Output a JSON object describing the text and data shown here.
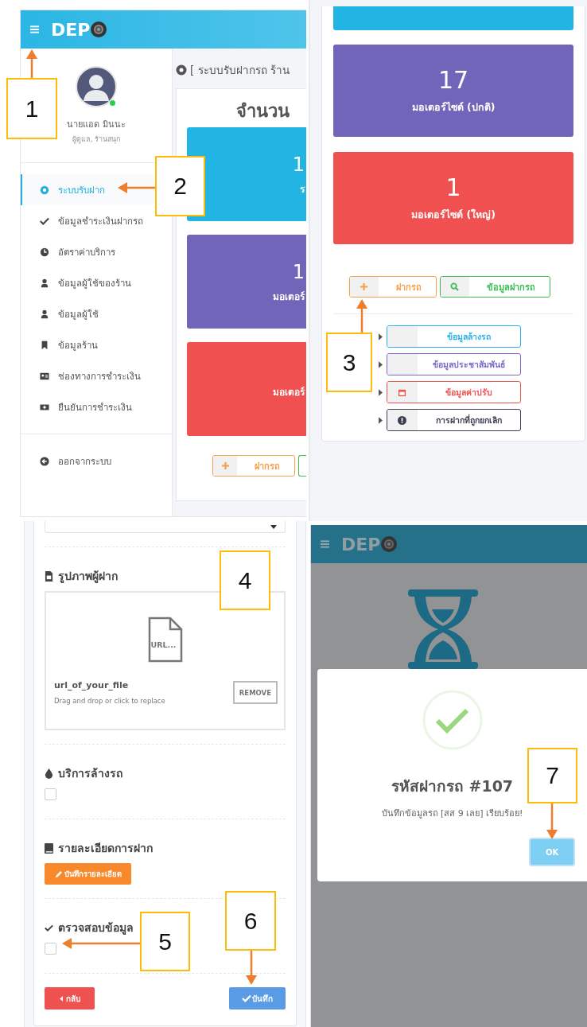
{
  "dashboard": {
    "logo": "DEP",
    "profile": {
      "name": "นายแอด มินนะ",
      "role": "ผู้ดูแล, ร้านสนุก",
      "online": true
    },
    "menu": [
      {
        "label": "ระบบรับฝาก",
        "selected": true
      },
      {
        "label": "ข้อมูลชำระเงินฝากรถ",
        "selected": false
      },
      {
        "label": "อัตราค่าบริการ",
        "selected": false
      },
      {
        "label": "ข้อมูลผู้ใช้ของร้าน",
        "selected": false
      },
      {
        "label": "ข้อมูลผู้ใช้",
        "selected": false
      },
      {
        "label": "ข้อมูลร้าน",
        "selected": false
      },
      {
        "label": "ช่องทางการชำระเงิน",
        "selected": false
      },
      {
        "label": "ยืนยันการชำระเงิน",
        "selected": false
      }
    ],
    "logout": "ออกจากระบบ",
    "page_title": "[ ระบบรับฝากรถ ร้าน",
    "card_title": "จำนวน",
    "tiles": [
      {
        "value": "1",
        "label": "ร",
        "color": "#22b5e4"
      },
      {
        "value": "1",
        "label": "มอเตอร์",
        "color": "#7165b9"
      },
      {
        "label": "มอเตอร์",
        "color": "#f05050"
      }
    ],
    "add_button": "ฝากรถ"
  },
  "dashboard_scrolled": {
    "tiles": [
      {
        "color": "#22b5e4"
      },
      {
        "value": "17",
        "label": "มอเตอร์ไซด์ (ปกติ)",
        "color": "#7165b9"
      },
      {
        "value": "1",
        "label": "มอเตอร์ไซด์ (ใหญ่)",
        "color": "#f05050"
      }
    ],
    "actions": [
      {
        "label": "ฝากรถ",
        "color": "#f7a04b"
      },
      {
        "label": "ข้อมูลฝากรถ",
        "color": "#3cbf56"
      }
    ],
    "links": [
      {
        "label": "ข้อมูลล้างรถ",
        "color": "#2bb1e6"
      },
      {
        "label": "ข้อมูลประชาสัมพันธ์",
        "color": "#7b68c4"
      },
      {
        "label": "ข้อมูลค่าปรับ",
        "color": "#ef5350"
      },
      {
        "label": "การฝากที่ถูกยกเลิก",
        "color": "#3a3f51"
      }
    ]
  },
  "deposit_form": {
    "photo_section": {
      "title": "รูปภาพผู้ฝาก",
      "file_preview": "URL...",
      "file_name": "url_of_your_file",
      "hint": "Drag and drop or click to replace",
      "remove_button": "REMOVE"
    },
    "wash_section": {
      "title": "บริการล้างรถ",
      "checked": false
    },
    "details_section": {
      "title": "รายละเอียดการฝาก",
      "button": "บันทึกรายละเอียด"
    },
    "verify_section": {
      "title": "ตรวจสอบข้อมูล",
      "checked": false
    },
    "back_button": "กลับ",
    "save_button": "บันทึก"
  },
  "success_dialog": {
    "logo": "DEP",
    "title": "รหัสฝากรถ #107",
    "message": "บันทึกข้อมูลรถ [สส 9 เลย] เรียบร้อย!",
    "ok_button": "OK"
  },
  "callouts": [
    "1",
    "2",
    "3",
    "4",
    "5",
    "6",
    "7"
  ]
}
